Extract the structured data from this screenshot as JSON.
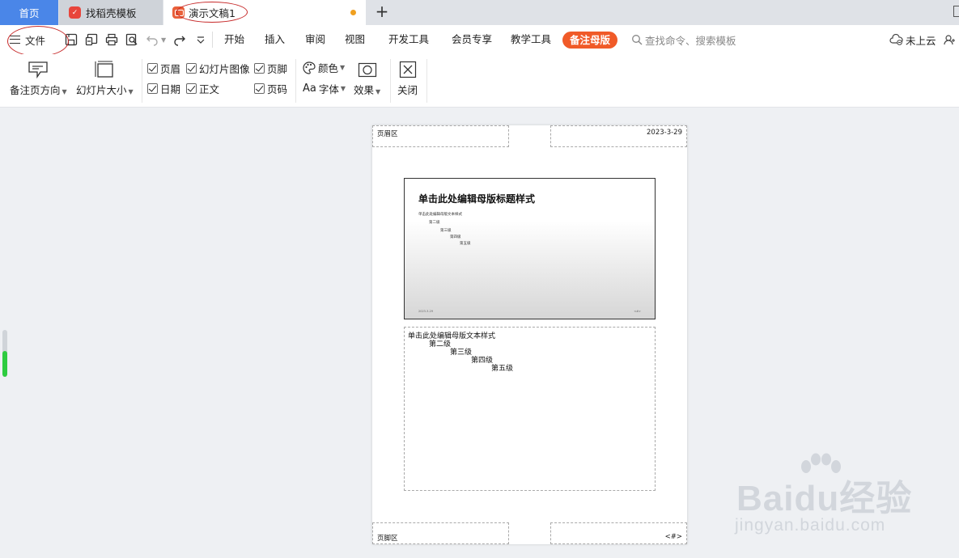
{
  "tabs": {
    "home": "首页",
    "templates": "找稻壳模板",
    "document": "演示文稿1"
  },
  "toolbar": {
    "file_label": "文件",
    "menu_tabs": [
      "开始",
      "插入",
      "审阅",
      "视图",
      "开发工具",
      "会员专享",
      "教学工具"
    ],
    "active_tab": "备注母版",
    "search_placeholder": "查找命令、搜索模板",
    "cloud_label": "未上云"
  },
  "ribbon": {
    "notes_direction": "备注页方向",
    "slide_size": "幻灯片大小",
    "checks": {
      "header": "页眉",
      "slide_image": "幻灯片图像",
      "footer": "页脚",
      "date": "日期",
      "body": "正文",
      "page_number": "页码"
    },
    "color": "颜色",
    "font": "字体",
    "font_prefix": "Aa",
    "effects": "效果",
    "close": "关闭"
  },
  "page": {
    "header_area": "页眉区",
    "date": "2023-3-29",
    "footer_area": "页脚区",
    "page_num": "<#>",
    "slide_title": "单击此处编辑母版标题样式",
    "slide_levels": [
      "单击此处编辑母版文本样式",
      "第二级",
      "第三级",
      "第四级",
      "第五级"
    ],
    "notes_levels": [
      "单击此处编辑母版文本样式",
      "第二级",
      "第三级",
      "第四级",
      "第五级"
    ]
  },
  "watermark": {
    "brand": "Baidu经验",
    "url": "jingyan.baidu.com"
  },
  "colors": {
    "accent": "#f05a28",
    "home_tab": "#4a86e8",
    "slider": "#2ecc40"
  }
}
